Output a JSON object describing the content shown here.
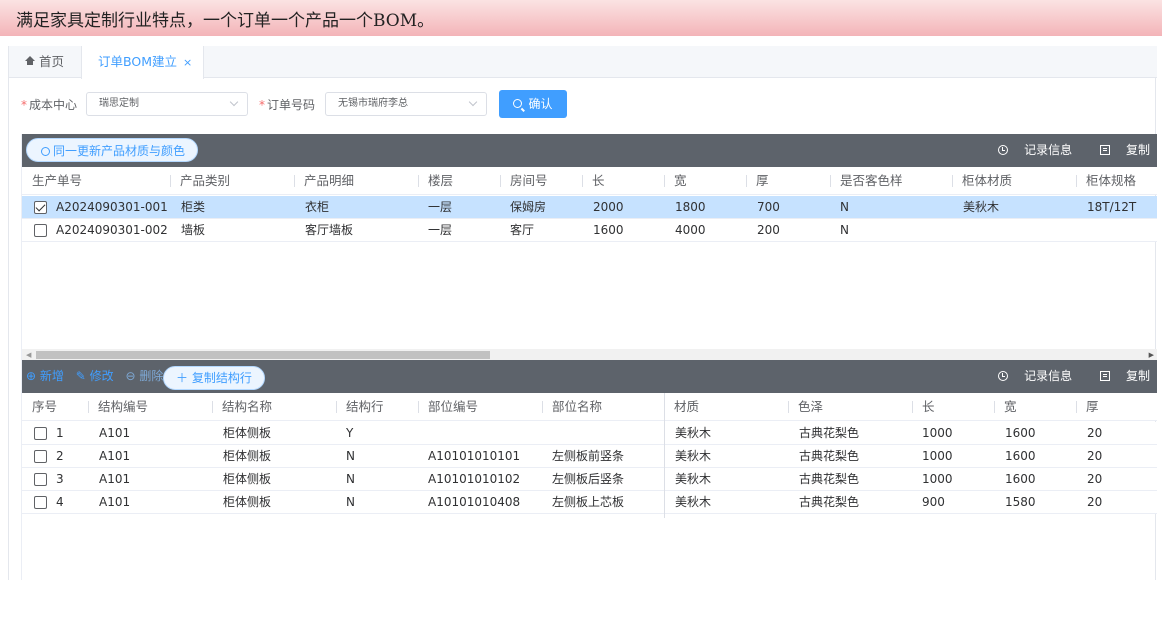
{
  "banner": {
    "text": "满足家具定制行业特点，一个订单一个产品一个BOM。"
  },
  "tabs": {
    "home": "首页",
    "active": "订单BOM建立",
    "close": "×"
  },
  "filter": {
    "cost_center_label": "成本中心",
    "cost_center_value": "瑞思定制",
    "order_no_label": "订单号码",
    "order_no_value": "无锡市瑞府李总",
    "confirm_label": "确认",
    "required_mark": "*"
  },
  "grid1": {
    "sync_label": "同一更新产品材质与颜色",
    "record_label": "记录信息",
    "copy_label": "复制",
    "columns": [
      "生产单号",
      "产品类别",
      "产品明细",
      "楼层",
      "房间号",
      "长",
      "宽",
      "厚",
      "是否客色样",
      "柜体材质",
      "柜体规格"
    ],
    "rows": [
      {
        "checked": true,
        "cells": [
          "A2024090301-001",
          "柜类",
          "衣柜",
          "一层",
          "保姆房",
          "2000",
          "1800",
          "700",
          "N",
          "美秋木",
          "18T/12T"
        ]
      },
      {
        "checked": false,
        "cells": [
          "A2024090301-002",
          "墙板",
          "客厅墙板",
          "一层",
          "客厅",
          "1600",
          "4000",
          "200",
          "N",
          "",
          ""
        ]
      }
    ]
  },
  "grid2": {
    "add_label": "新增",
    "edit_label": "修改",
    "delete_label": "删除",
    "copy_struct_label": "复制结构行",
    "record_label": "记录信息",
    "copy_label": "复制",
    "columns": [
      "序号",
      "结构编号",
      "结构名称",
      "结构行",
      "部位编号",
      "部位名称",
      "材质",
      "色泽",
      "长",
      "宽",
      "厚"
    ],
    "rows": [
      [
        "1",
        "A101",
        "柜体侧板",
        "Y",
        "",
        "",
        "美秋木",
        "古典花梨色",
        "1000",
        "1600",
        "20"
      ],
      [
        "2",
        "A101",
        "柜体侧板",
        "N",
        "A10101010101",
        "左侧板前竖条",
        "美秋木",
        "古典花梨色",
        "1000",
        "1600",
        "20"
      ],
      [
        "3",
        "A101",
        "柜体侧板",
        "N",
        "A10101010102",
        "左侧板后竖条",
        "美秋木",
        "古典花梨色",
        "1000",
        "1600",
        "20"
      ],
      [
        "4",
        "A101",
        "柜体侧板",
        "N",
        "A10101010408",
        "左侧板上芯板",
        "美秋木",
        "古典花梨色",
        "900",
        "1580",
        "20"
      ]
    ]
  }
}
